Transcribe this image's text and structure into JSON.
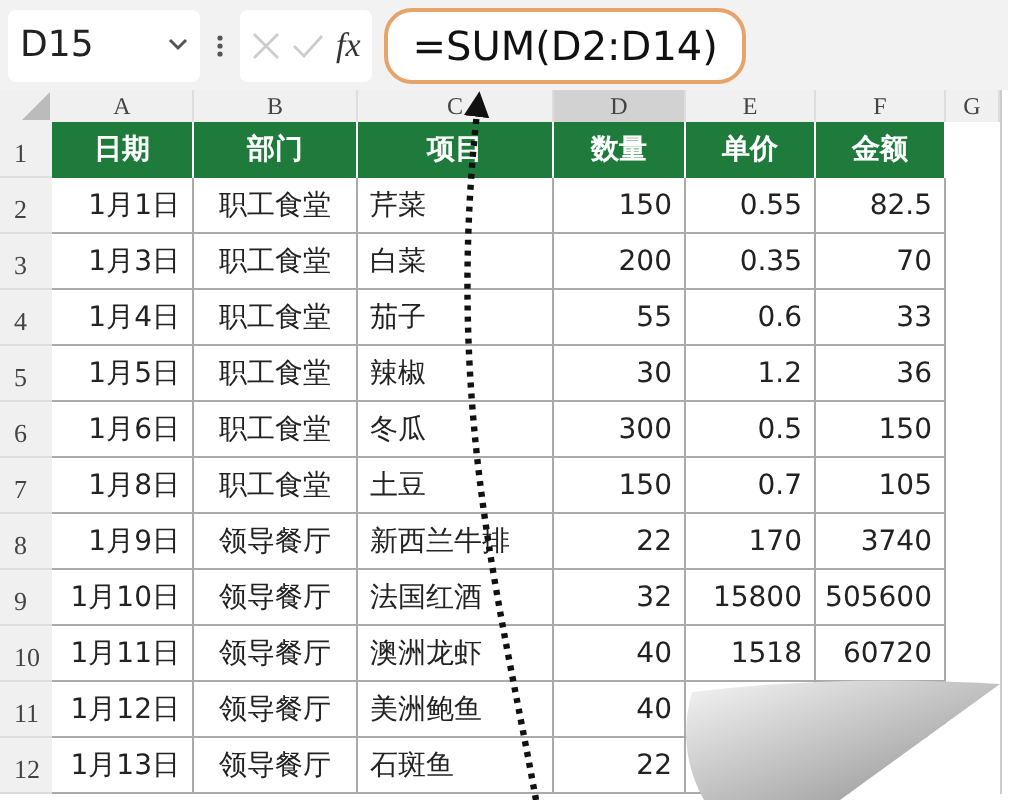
{
  "formula_bar": {
    "name_box": "D15",
    "function_label": "fx",
    "formula": "=SUM(D2:D14)"
  },
  "column_headers": [
    {
      "label": "A",
      "selected": false
    },
    {
      "label": "B",
      "selected": false
    },
    {
      "label": "C",
      "selected": false
    },
    {
      "label": "D",
      "selected": true
    },
    {
      "label": "E",
      "selected": false
    },
    {
      "label": "F",
      "selected": false
    },
    {
      "label": "G",
      "selected": false
    }
  ],
  "table": {
    "columns": [
      "日期",
      "部门",
      "项目",
      "数量",
      "单价",
      "金额"
    ],
    "rows": [
      {
        "row_number": "1"
      },
      {
        "row_number": "2",
        "cells": [
          "1月1日",
          "职工食堂",
          "芹菜",
          "150",
          "0.55",
          "82.5"
        ]
      },
      {
        "row_number": "3",
        "cells": [
          "1月3日",
          "职工食堂",
          "白菜",
          "200",
          "0.35",
          "70"
        ]
      },
      {
        "row_number": "4",
        "cells": [
          "1月4日",
          "职工食堂",
          "茄子",
          "55",
          "0.6",
          "33"
        ]
      },
      {
        "row_number": "5",
        "cells": [
          "1月5日",
          "职工食堂",
          "辣椒",
          "30",
          "1.2",
          "36"
        ]
      },
      {
        "row_number": "6",
        "cells": [
          "1月6日",
          "职工食堂",
          "冬瓜",
          "300",
          "0.5",
          "150"
        ]
      },
      {
        "row_number": "7",
        "cells": [
          "1月8日",
          "职工食堂",
          "土豆",
          "150",
          "0.7",
          "105"
        ]
      },
      {
        "row_number": "8",
        "cells": [
          "1月9日",
          "领导餐厅",
          "新西兰牛排",
          "22",
          "170",
          "3740"
        ]
      },
      {
        "row_number": "9",
        "cells": [
          "1月10日",
          "领导餐厅",
          "法国红酒",
          "32",
          "15800",
          "505600"
        ]
      },
      {
        "row_number": "10",
        "cells": [
          "1月11日",
          "领导餐厅",
          "澳洲龙虾",
          "40",
          "1518",
          "60720"
        ]
      },
      {
        "row_number": "11",
        "cells": [
          "1月12日",
          "领导餐厅",
          "美洲鲍鱼",
          "40"
        ]
      },
      {
        "row_number": "12",
        "cells": [
          "1月13日",
          "领导餐厅",
          "石斑鱼",
          "22"
        ]
      }
    ]
  }
}
